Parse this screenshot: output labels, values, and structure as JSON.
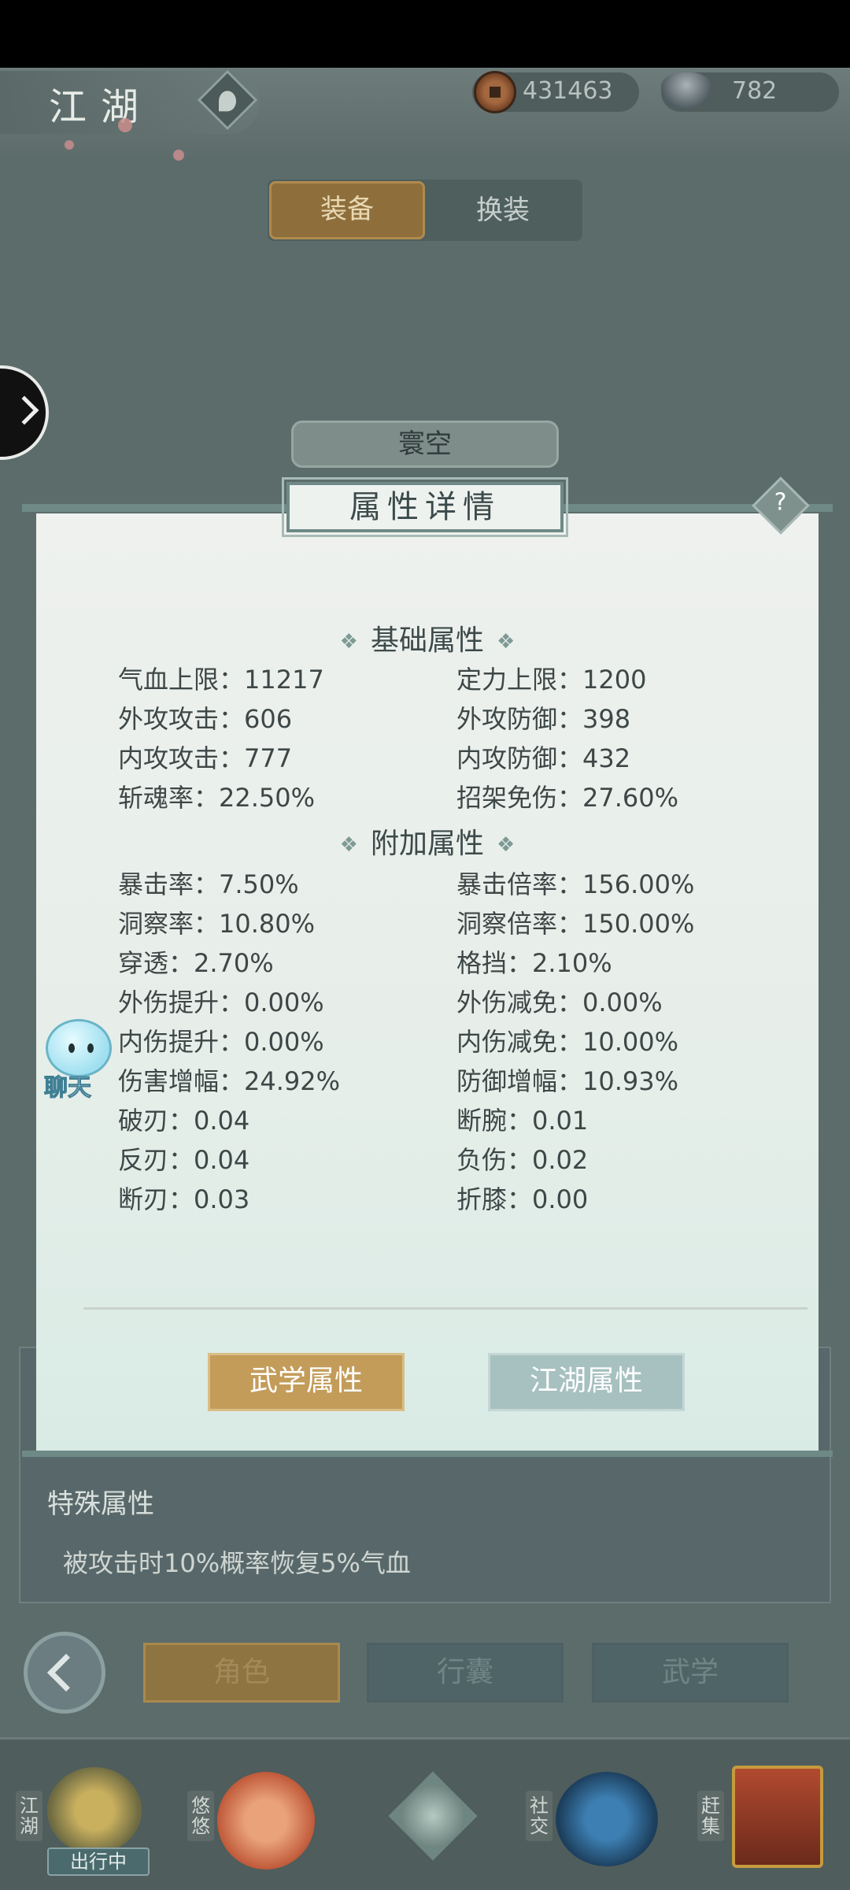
{
  "header": {
    "location_title": "江湖",
    "copper": "431463",
    "silver": "782"
  },
  "equip_tabs": [
    "装备",
    "换装"
  ],
  "character_name": "寰空",
  "modal": {
    "title": "属性详情",
    "help_label": "?",
    "base_section": "基础属性",
    "extra_section": "附加属性",
    "base_attrs": [
      "气血上限：11217",
      "定力上限：1200",
      "外攻攻击：606",
      "外攻防御：398",
      "内攻攻击：777",
      "内攻防御：432",
      "斩魂率：22.50%",
      "招架免伤：27.60%"
    ],
    "extra_attrs": [
      "暴击率：7.50%",
      "暴击倍率：156.00%",
      "洞察率：10.80%",
      "洞察倍率：150.00%",
      "穿透：2.70%",
      "格挡：2.10%",
      "外伤提升：0.00%",
      "外伤减免：0.00%",
      "内伤提升：0.00%",
      "内伤减免：10.00%",
      "伤害增幅：24.92%",
      "防御增幅：10.93%",
      "破刃：0.04",
      "断腕：0.01",
      "反刃：0.04",
      "负伤：0.02",
      "断刃：0.03",
      "折膝：0.00"
    ],
    "btn_martial": "武学属性",
    "btn_jianghu": "江湖属性"
  },
  "chat_label": "聊天",
  "special": {
    "title": "特殊属性",
    "text": "被攻击时10%概率恢复5%气血"
  },
  "bottom_tabs": [
    "角色",
    "行囊",
    "武学"
  ],
  "nav": {
    "jianghu": "江湖",
    "status": "出行中",
    "youyou": "悠悠",
    "social": "社交",
    "market": "赶集"
  },
  "colors": {
    "accent_gold": "#c39c5a",
    "accent_teal": "#a7c0c0",
    "panel_bg": "#eef1ee"
  }
}
